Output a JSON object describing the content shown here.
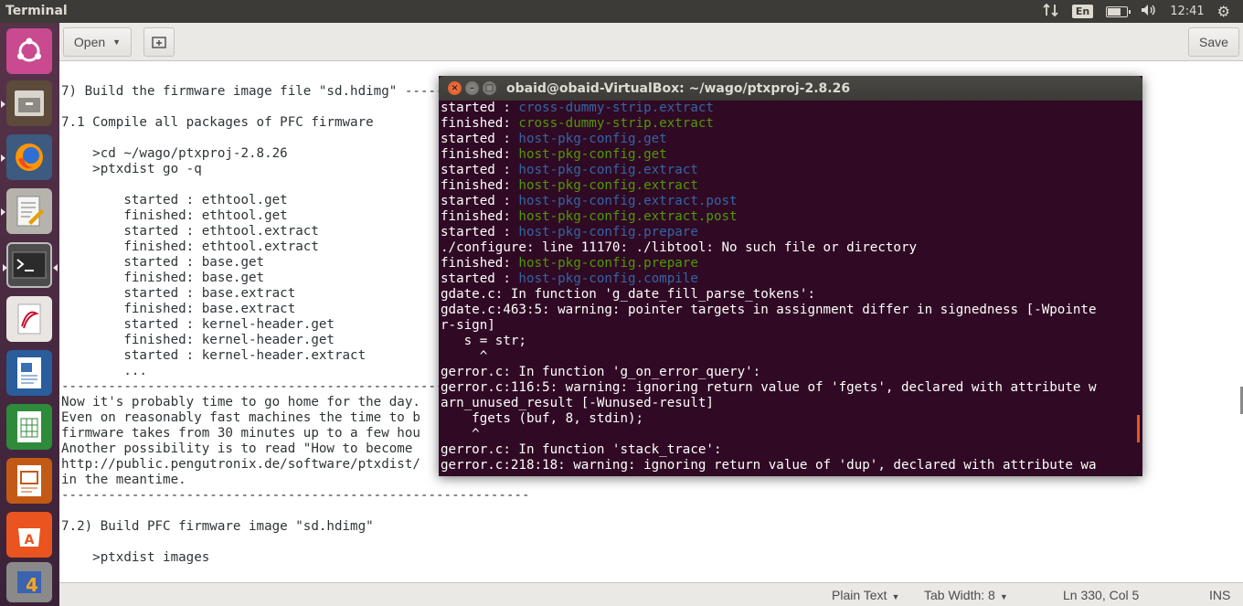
{
  "topbar": {
    "app_name": "Terminal",
    "keyboard_layout": "En",
    "time": "12:41",
    "battery_level": 0.75
  },
  "launcher": {
    "items": [
      {
        "name": "Ubuntu Dash"
      },
      {
        "name": "Files"
      },
      {
        "name": "Firefox"
      },
      {
        "name": "Text Editor"
      },
      {
        "name": "Terminal"
      },
      {
        "name": "Document Viewer"
      },
      {
        "name": "LibreOffice Writer"
      },
      {
        "name": "LibreOffice Calc"
      },
      {
        "name": "LibreOffice Impress"
      },
      {
        "name": "Ubuntu Software"
      },
      {
        "name": "Software Updater"
      }
    ]
  },
  "gedit": {
    "open_label": "Open",
    "save_label": "Save",
    "lines": [
      "7) Build the firmware image file \"sd.hdimg\" -----------------------",
      "",
      "7.1 Compile all packages of PFC firmware",
      "",
      "    >cd ~/wago/ptxproj-2.8.26",
      "    >ptxdist go -q",
      "",
      "        started : ethtool.get",
      "        finished: ethtool.get",
      "        started : ethtool.extract",
      "        finished: ethtool.extract",
      "        started : base.get",
      "        finished: base.get",
      "        started : base.extract",
      "        finished: base.extract",
      "        started : kernel-header.get",
      "        finished: kernel-header.get",
      "        started : kernel-header.extract",
      "        ...",
      "------------------------------------------------------------",
      "Now it's probably time to go home for the day.",
      "Even on reasonably fast machines the time to b",
      "firmware takes from 30 minutes up to a few hou",
      "Another possibility is to read \"How to become",
      "http://public.pengutronix.de/software/ptxdist/",
      "in the meantime.",
      "------------------------------------------------------------",
      "",
      "7.2) Build PFC firmware image \"sd.hdimg\"",
      "",
      "    >ptxdist images"
    ],
    "status": {
      "syntax": "Plain Text",
      "tab_width": "Tab Width: 8",
      "position": "Ln 330, Col 5",
      "mode": "INS"
    }
  },
  "terminal": {
    "title": "obaid@obaid-VirtualBox: ~/wago/ptxproj-2.8.26",
    "lines": [
      {
        "prefix": "started : ",
        "text": "cross-dummy-strip.extract",
        "color": "#3465a4"
      },
      {
        "prefix": "finished: ",
        "text": "cross-dummy-strip.extract",
        "color": "#4e9a06"
      },
      {
        "prefix": "started : ",
        "text": "host-pkg-config.get",
        "color": "#3465a4"
      },
      {
        "prefix": "finished: ",
        "text": "host-pkg-config.get",
        "color": "#4e9a06"
      },
      {
        "prefix": "started : ",
        "text": "host-pkg-config.extract",
        "color": "#3465a4"
      },
      {
        "prefix": "finished: ",
        "text": "host-pkg-config.extract",
        "color": "#4e9a06"
      },
      {
        "prefix": "started : ",
        "text": "host-pkg-config.extract.post",
        "color": "#3465a4"
      },
      {
        "prefix": "finished: ",
        "text": "host-pkg-config.extract.post",
        "color": "#4e9a06"
      },
      {
        "prefix": "started : ",
        "text": "host-pkg-config.prepare",
        "color": "#3465a4"
      },
      {
        "prefix": "./configure: line 11170: ./libtool: No such file or directory",
        "text": "",
        "color": "#ffffff"
      },
      {
        "prefix": "finished: ",
        "text": "host-pkg-config.prepare",
        "color": "#4e9a06"
      },
      {
        "prefix": "started : ",
        "text": "host-pkg-config.compile",
        "color": "#3465a4"
      },
      {
        "prefix": "gdate.c: In function 'g_date_fill_parse_tokens':",
        "text": "",
        "color": "#ffffff"
      },
      {
        "prefix": "gdate.c:463:5: warning: pointer targets in assignment differ in signedness [-Wpointe",
        "text": "",
        "color": "#ffffff"
      },
      {
        "prefix": "r-sign]",
        "text": "",
        "color": "#ffffff"
      },
      {
        "prefix": "   s = str;",
        "text": "",
        "color": "#ffffff"
      },
      {
        "prefix": "     ^",
        "text": "",
        "color": "#ffffff"
      },
      {
        "prefix": "gerror.c: In function 'g_on_error_query':",
        "text": "",
        "color": "#ffffff"
      },
      {
        "prefix": "gerror.c:116:5: warning: ignoring return value of 'fgets', declared with attribute w",
        "text": "",
        "color": "#ffffff"
      },
      {
        "prefix": "arn_unused_result [-Wunused-result]",
        "text": "",
        "color": "#ffffff"
      },
      {
        "prefix": "    fgets (buf, 8, stdin);",
        "text": "",
        "color": "#ffffff"
      },
      {
        "prefix": "    ^",
        "text": "",
        "color": "#ffffff"
      },
      {
        "prefix": "gerror.c: In function 'stack_trace':",
        "text": "",
        "color": "#ffffff"
      },
      {
        "prefix": "gerror.c:218:18: warning: ignoring return value of 'dup', declared with attribute wa",
        "text": "",
        "color": "#ffffff"
      }
    ]
  }
}
